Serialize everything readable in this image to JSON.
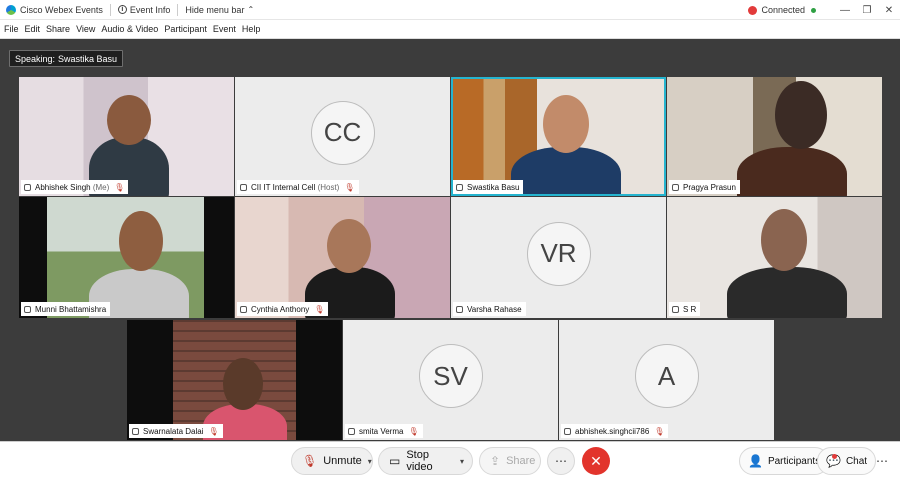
{
  "titlebar": {
    "app_name": "Cisco Webex Events",
    "event_info": "Event Info",
    "hide_menu": "Hide menu bar",
    "status": "Connected",
    "status_colors": {
      "icon": "#e23b3b",
      "dot": "#2ea043"
    }
  },
  "menu": [
    "File",
    "Edit",
    "Share",
    "View",
    "Audio & Video",
    "Participant",
    "Event",
    "Help"
  ],
  "speaking": {
    "label": "Speaking:",
    "name": "Swastika Basu"
  },
  "tiles": [
    {
      "name": "Abhishek Singh",
      "suffix": "(Me)",
      "video": true
    },
    {
      "name": "CII IT Internal Cell",
      "suffix": "(Host)",
      "initials": "CC",
      "video": false
    },
    {
      "name": "Swastika Basu",
      "video": true,
      "active": true
    },
    {
      "name": "Pragya Prasun",
      "video": true
    },
    {
      "name": "Munni Bhattamishra",
      "video": true
    },
    {
      "name": "Cynthia Anthony",
      "video": true
    },
    {
      "name": "Varsha Rahase",
      "initials": "VR",
      "video": false
    },
    {
      "name": "S R",
      "video": true
    },
    {
      "name": "Swarnalata Dalai",
      "video": true
    },
    {
      "name": "smita Verma",
      "initials": "SV",
      "video": false
    },
    {
      "name": "abhishek.singhcii786",
      "initials": "A",
      "video": false
    }
  ],
  "controls": {
    "unmute": "Unmute",
    "stop_video": "Stop video",
    "share": "Share",
    "participants": "Participants",
    "chat": "Chat",
    "leave_color": "#e2342c",
    "active_border_color": "#25b4cf"
  }
}
